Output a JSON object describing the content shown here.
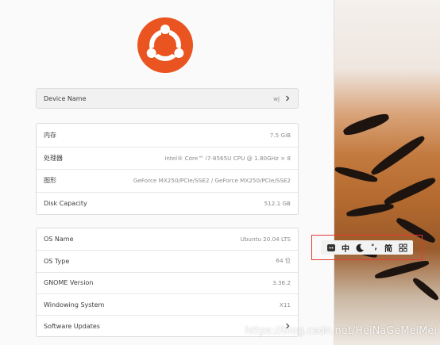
{
  "colors": {
    "accent": "#e95420",
    "card_bg": "#ffffff",
    "panel_bg": "#fafafa",
    "highlight": "#e53935"
  },
  "logo": {
    "icon": "ubuntu-logo"
  },
  "device": {
    "label": "Device Name",
    "value": "wj",
    "icon": "chevron-right-icon"
  },
  "hardware": [
    {
      "label": "内存",
      "value": "7.5 GiB"
    },
    {
      "label": "处理器",
      "value": "Intel® Core™ i7-8565U CPU @ 1.80GHz × 8"
    },
    {
      "label": "图形",
      "value": "GeForce MX250/PCIe/SSE2 / GeForce MX250/PCIe/SSE2"
    },
    {
      "label": "Disk Capacity",
      "value": "512.1 GB"
    }
  ],
  "os": [
    {
      "label": "OS Name",
      "value": "Ubuntu 20.04 LTS"
    },
    {
      "label": "OS Type",
      "value": "64 位"
    },
    {
      "label": "GNOME Version",
      "value": "3.36.2"
    },
    {
      "label": "Windowing System",
      "value": "X11"
    },
    {
      "label": "Software Updates",
      "value": "",
      "icon": "chevron-right-icon"
    }
  ],
  "ime_toolbar": {
    "items": [
      {
        "name": "ime-logo-icon",
        "text": ""
      },
      {
        "name": "ime-mode-chinese",
        "text": "中"
      },
      {
        "name": "ime-moon-icon",
        "text": ""
      },
      {
        "name": "ime-punct-icon",
        "text": "°,"
      },
      {
        "name": "ime-simplified",
        "text": "简"
      },
      {
        "name": "ime-grid-icon",
        "text": ""
      }
    ]
  },
  "watermark": "https://blog.csdn.net/HeiNaGeMeiMei"
}
